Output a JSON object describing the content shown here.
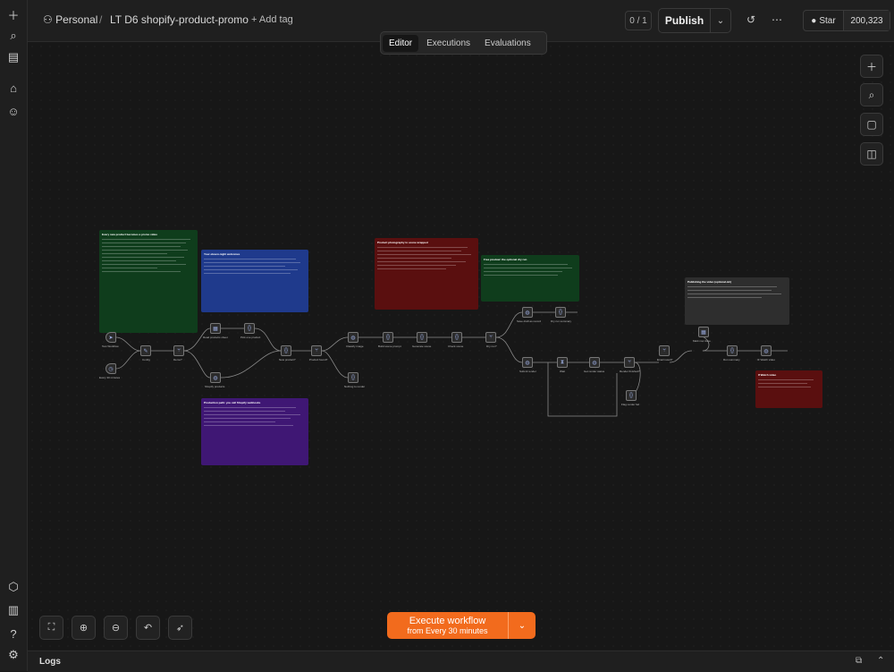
{
  "header": {
    "project": "Personal",
    "workflow_name": "LT D6 shopify-product-promo",
    "add_tag": "+ Add tag",
    "version_counter": "0 / 1",
    "publish_label": "Publish",
    "github_star": "Star",
    "github_count": "200,323"
  },
  "tabs": [
    "Editor",
    "Executions",
    "Evaluations"
  ],
  "canvas": {
    "notes": [
      {
        "title": "Every new product becomes a promo video",
        "color": "#0f3d1c"
      },
      {
        "title": "Your eleven-night welcomes",
        "color": "#1f3a8c"
      },
      {
        "title": "Production path: you call Shopify webhooks",
        "color": "#3f1774"
      },
      {
        "title": "Product photography to scene wrapped",
        "color": "#5a0f0f"
      },
      {
        "title": "Free preview: the optional dry run",
        "color": "#0f3d1c"
      },
      {
        "title": "Publishing the video (optional-ish)",
        "color": "#2e2e2e"
      },
      {
        "title": "If Watch video",
        "color": "#5a0f0f"
      }
    ],
    "nodes": [
      {
        "label": "Every 30 minutes",
        "icon": "clock-icon"
      },
      {
        "label": "Test Workflow",
        "icon": "cursor-icon"
      },
      {
        "label": "Config",
        "icon": "pen-icon"
      },
      {
        "label": "Demo?",
        "icon": "split-icon"
      },
      {
        "label": "Read products sheet",
        "icon": "sheet-icon"
      },
      {
        "label": "Shopify products",
        "icon": "globe-icon"
      },
      {
        "label": "Pick one product",
        "icon": "code-icon"
      },
      {
        "label": "New product?",
        "icon": "code-icon"
      },
      {
        "label": "Product found?",
        "icon": "split-icon"
      },
      {
        "label": "Nothing to render",
        "icon": "code-icon"
      },
      {
        "label": "Classify image",
        "icon": "globe-icon"
      },
      {
        "label": "Build scene prompt",
        "icon": "code-icon"
      },
      {
        "label": "Generate scene",
        "icon": "code-icon"
      },
      {
        "label": "Check scene",
        "icon": "code-icon"
      },
      {
        "label": "Dry run?",
        "icon": "split-icon"
      },
      {
        "label": "Save draft as record",
        "icon": "globe-icon"
      },
      {
        "label": "Dry run summary",
        "icon": "code-icon"
      },
      {
        "label": "Submit render",
        "icon": "globe-icon"
      },
      {
        "label": "Wait",
        "icon": "hourglass-icon"
      },
      {
        "label": "Get render status",
        "icon": "globe-icon"
      },
      {
        "label": "Render finished?",
        "icon": "split-icon"
      },
      {
        "label": "Flag render fail",
        "icon": "code-icon"
      },
      {
        "label": "Email result?",
        "icon": "split-icon"
      },
      {
        "label": "Mark row done",
        "icon": "sheet-icon"
      },
      {
        "label": "Run summary",
        "icon": "code-icon"
      },
      {
        "label": "IF Watch video",
        "icon": "globe-icon"
      }
    ]
  },
  "execute": {
    "label": "Execute workflow",
    "sublabel": "from Every 30 minutes"
  },
  "logs_label": "Logs"
}
